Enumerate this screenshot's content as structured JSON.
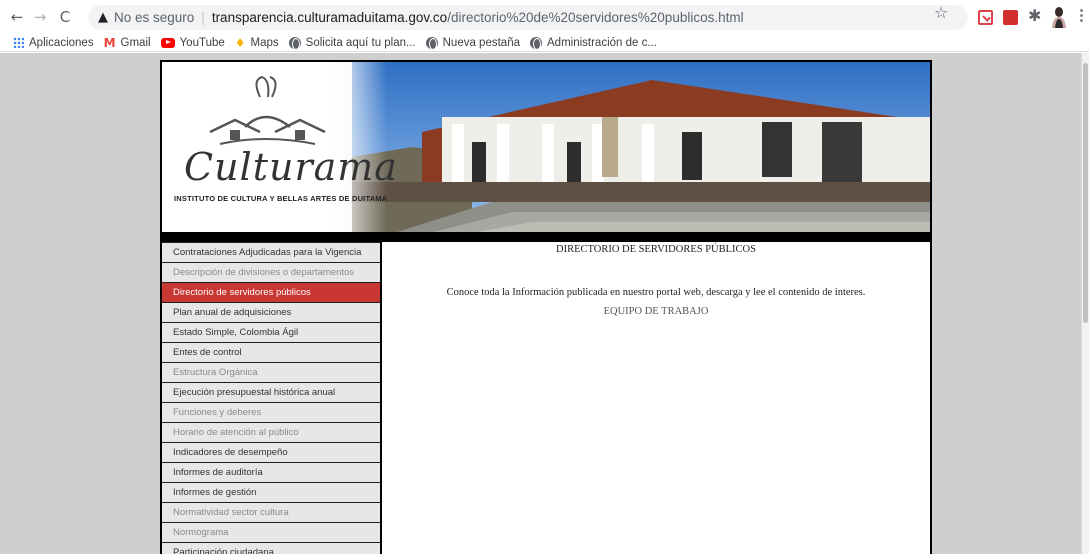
{
  "browser": {
    "security_label": "No es seguro",
    "url_host": "transparencia.culturamaduitama.gov.co",
    "url_path": "/directorio%20de%20servidores%20publicos.html",
    "bookmarks": [
      {
        "label": "Aplicaciones",
        "icon": "apps-grid-icon"
      },
      {
        "label": "Gmail",
        "icon": "gmail-icon"
      },
      {
        "label": "YouTube",
        "icon": "youtube-icon"
      },
      {
        "label": "Maps",
        "icon": "maps-pin-icon"
      },
      {
        "label": "Solicita aquí tu plan...",
        "icon": "globe-icon"
      },
      {
        "label": "Nueva pestaña",
        "icon": "globe-icon"
      },
      {
        "label": "Administración de c...",
        "icon": "globe-icon"
      }
    ]
  },
  "site": {
    "logo_text": "Culturama",
    "institute_name": "INSTITUTO DE CULTURA Y BELLAS ARTES DE DUITAMA",
    "menu": [
      {
        "label": "Contrataciones Adjudicadas para la Vigencia",
        "state": "normal"
      },
      {
        "label": "Descripción de divisiones o departamentos",
        "state": "dim"
      },
      {
        "label": "Directorio de servidores públicos",
        "state": "active"
      },
      {
        "label": "Plan anual de adquisiciones",
        "state": "normal"
      },
      {
        "label": "Estado Simple, Colombia Ágil",
        "state": "normal"
      },
      {
        "label": "Entes de control",
        "state": "normal"
      },
      {
        "label": "Estructura Orgánica",
        "state": "dim"
      },
      {
        "label": "Ejecución presupuestal histórica anual",
        "state": "normal"
      },
      {
        "label": "Funciones y deberes",
        "state": "dim"
      },
      {
        "label": "Horario de atención al público",
        "state": "dim"
      },
      {
        "label": "Indicadores de desempeño",
        "state": "normal"
      },
      {
        "label": "Informes de auditoría",
        "state": "normal"
      },
      {
        "label": "Informes de gestión",
        "state": "normal"
      },
      {
        "label": "Normatividad sector cultura",
        "state": "dim"
      },
      {
        "label": "Normograma",
        "state": "dim"
      },
      {
        "label": "Participación ciudadana",
        "state": "normal"
      }
    ],
    "content": {
      "heading": "DIRECTORIO DE SERVIDORES PÚBLICOS",
      "intro": "Conoce toda la Información publicada en nuestro portal web, descarga y lee el contenido de interes.",
      "team": "EQUIPO DE TRABAJO"
    },
    "colors": {
      "active": "#c83732",
      "menu_bg": "#e7e7e7",
      "page_bg": "#cfcfcf"
    }
  }
}
